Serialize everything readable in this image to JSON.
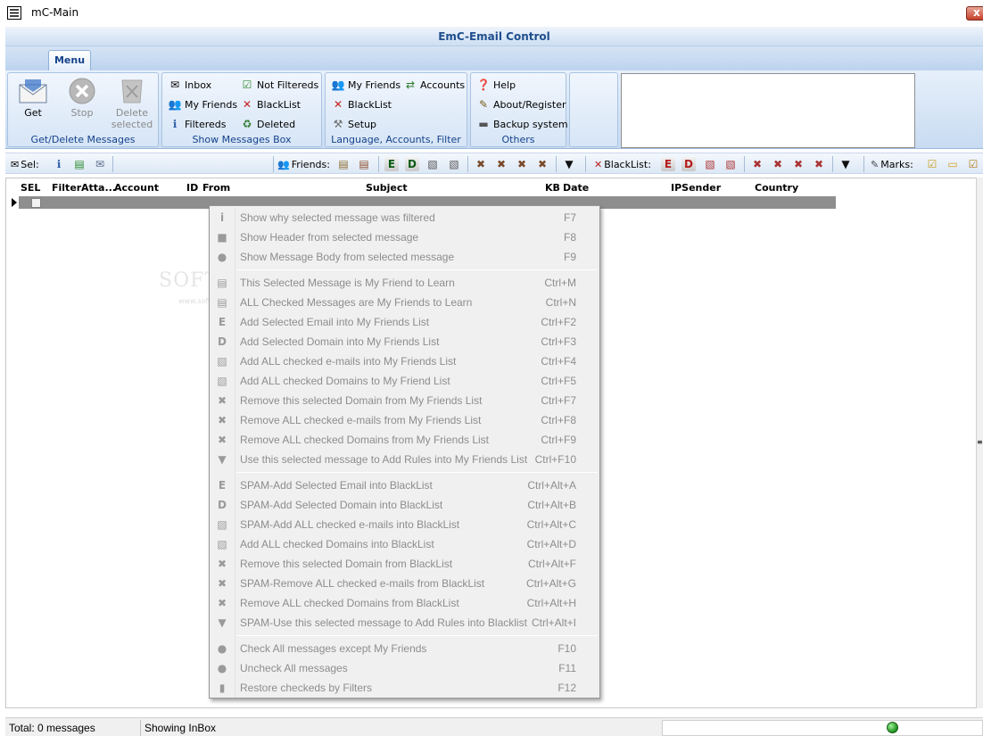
{
  "window": {
    "title": "mC-Main"
  },
  "app": {
    "title": "EmC-Email Control"
  },
  "ribbon": {
    "tab": "Menu",
    "groups": {
      "get_delete": {
        "label": "Get/Delete Messages",
        "get": "Get",
        "stop": "Stop",
        "delete_line1": "Delete",
        "delete_line2": "selected"
      },
      "show": {
        "label": "Show Messages Box",
        "inbox": "Inbox",
        "my_friends": "My Friends",
        "filtereds": "Filtereds",
        "not_filtereds": "Not Filtereds",
        "blacklist": "BlackList",
        "deleted": "Deleted"
      },
      "lang": {
        "label": "Language, Accounts, Filter",
        "my_friends": "My Friends",
        "accounts": "Accounts",
        "blacklist": "BlackList",
        "setup": "Setup"
      },
      "others": {
        "label": "Others",
        "help": "Help",
        "about": "About/Register",
        "backup": "Backup system"
      }
    }
  },
  "toolbar": {
    "sel": "Sel:",
    "friends": "Friends:",
    "blacklist": "BlackList:",
    "marks": "Marks:",
    "letter_e": "E",
    "letter_d": "D"
  },
  "grid": {
    "columns": [
      "SEL",
      "Filter",
      "Atta...",
      "Account",
      "ID",
      "From",
      "Subject",
      "KB",
      "Date",
      "IPSender",
      "Country"
    ]
  },
  "watermark": {
    "main": "SOFTPEDIA",
    "sub": "www.softpedia.com"
  },
  "context_menu": {
    "items": [
      {
        "icon": "i",
        "label": "Show why selected message was filtered",
        "shortcut": "F7"
      },
      {
        "icon": "■",
        "label": "Show Header from selected message",
        "shortcut": "F8"
      },
      {
        "icon": "●",
        "label": "Show Message Body from selected message",
        "shortcut": "F9"
      },
      {
        "icon": "▤",
        "label": "This Selected Message is My Friend to Learn",
        "shortcut": "Ctrl+M"
      },
      {
        "icon": "▤",
        "label": "ALL Checked Messages are My Friends to Learn",
        "shortcut": "Ctrl+N"
      },
      {
        "icon": "E",
        "label": "Add Selected Email into My Friends List",
        "shortcut": "Ctrl+F2"
      },
      {
        "icon": "D",
        "label": "Add Selected Domain into My Friends List",
        "shortcut": "Ctrl+F3"
      },
      {
        "icon": "▧",
        "label": "Add ALL checked e-mails into My Friends List",
        "shortcut": "Ctrl+F4"
      },
      {
        "icon": "▧",
        "label": "Add ALL checked Domains to My Friend List",
        "shortcut": "Ctrl+F5"
      },
      {
        "icon": "✖",
        "label": "Remove this selected Domain from My Friends List",
        "shortcut": "Ctrl+F7"
      },
      {
        "icon": "✖",
        "label": "Remove ALL checked e-mails from My Friends List",
        "shortcut": "Ctrl+F8"
      },
      {
        "icon": "✖",
        "label": "Remove ALL checked Domains from My Friends List",
        "shortcut": "Ctrl+F9"
      },
      {
        "icon": "▼",
        "label": "Use this selected message to Add Rules into My Friends List",
        "shortcut": "Ctrl+F10"
      },
      {
        "icon": "E",
        "label": "SPAM-Add Selected Email into BlackList",
        "shortcut": "Ctrl+Alt+A"
      },
      {
        "icon": "D",
        "label": "SPAM-Add Selected Domain into BlackList",
        "shortcut": "Ctrl+Alt+B"
      },
      {
        "icon": "▧",
        "label": "SPAM-Add ALL checked e-mails into BlackList",
        "shortcut": "Ctrl+Alt+C"
      },
      {
        "icon": "▧",
        "label": "Add ALL checked Domains into BlackList",
        "shortcut": "Ctrl+Alt+D"
      },
      {
        "icon": "✖",
        "label": "Remove this selected Domain from BlackList",
        "shortcut": "Ctrl+Alt+F"
      },
      {
        "icon": "✖",
        "label": "SPAM-Remove ALL checked e-mails from BlackList",
        "shortcut": "Ctrl+Alt+G"
      },
      {
        "icon": "✖",
        "label": "Remove ALL checked Domains from BlackList",
        "shortcut": "Ctrl+Alt+H"
      },
      {
        "icon": "▼",
        "label": "SPAM-Use this selected message to Add Rules into Blacklist",
        "shortcut": "Ctrl+Alt+I"
      },
      {
        "icon": "●",
        "label": "Check All messages except My Friends",
        "shortcut": "F10"
      },
      {
        "icon": "●",
        "label": "Uncheck All messages",
        "shortcut": "F11"
      },
      {
        "icon": "▮",
        "label": "Restore checkeds by Filters",
        "shortcut": "F12"
      }
    ]
  },
  "status": {
    "total": "Total: 0 messages",
    "showing": "Showing InBox"
  }
}
